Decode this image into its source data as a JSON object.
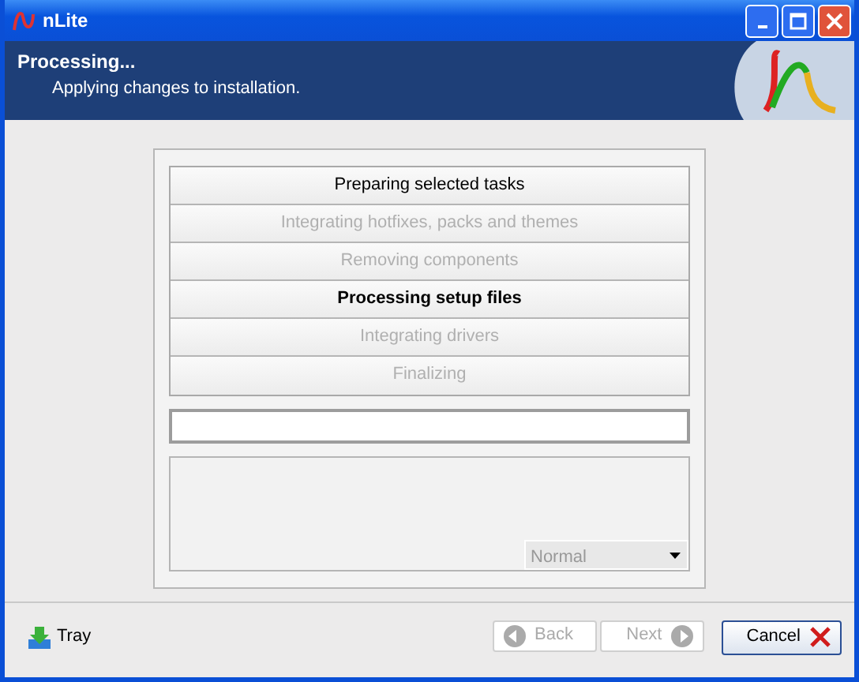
{
  "window": {
    "title": "nLite"
  },
  "header": {
    "title": "Processing...",
    "subtitle": "Applying changes to installation."
  },
  "steps": [
    {
      "label": "Preparing selected tasks",
      "done": true,
      "selected": false
    },
    {
      "label": "Integrating hotfixes, packs and themes",
      "done": false,
      "selected": false
    },
    {
      "label": "Removing components",
      "done": false,
      "selected": false
    },
    {
      "label": "Processing setup files",
      "done": false,
      "selected": true
    },
    {
      "label": "Integrating drivers",
      "done": false,
      "selected": false
    },
    {
      "label": "Finalizing",
      "done": false,
      "selected": false
    }
  ],
  "progress": {
    "level": 0
  },
  "priority": {
    "value": "Normal",
    "disabled": true
  },
  "footer": {
    "tray": "Tray",
    "buttons": [
      {
        "label": "Back",
        "kind": "back",
        "disabled": true
      },
      {
        "label": "Next",
        "kind": "next",
        "disabled": true
      },
      {
        "label": "Cancel",
        "kind": "cancel",
        "disabled": false
      }
    ]
  }
}
